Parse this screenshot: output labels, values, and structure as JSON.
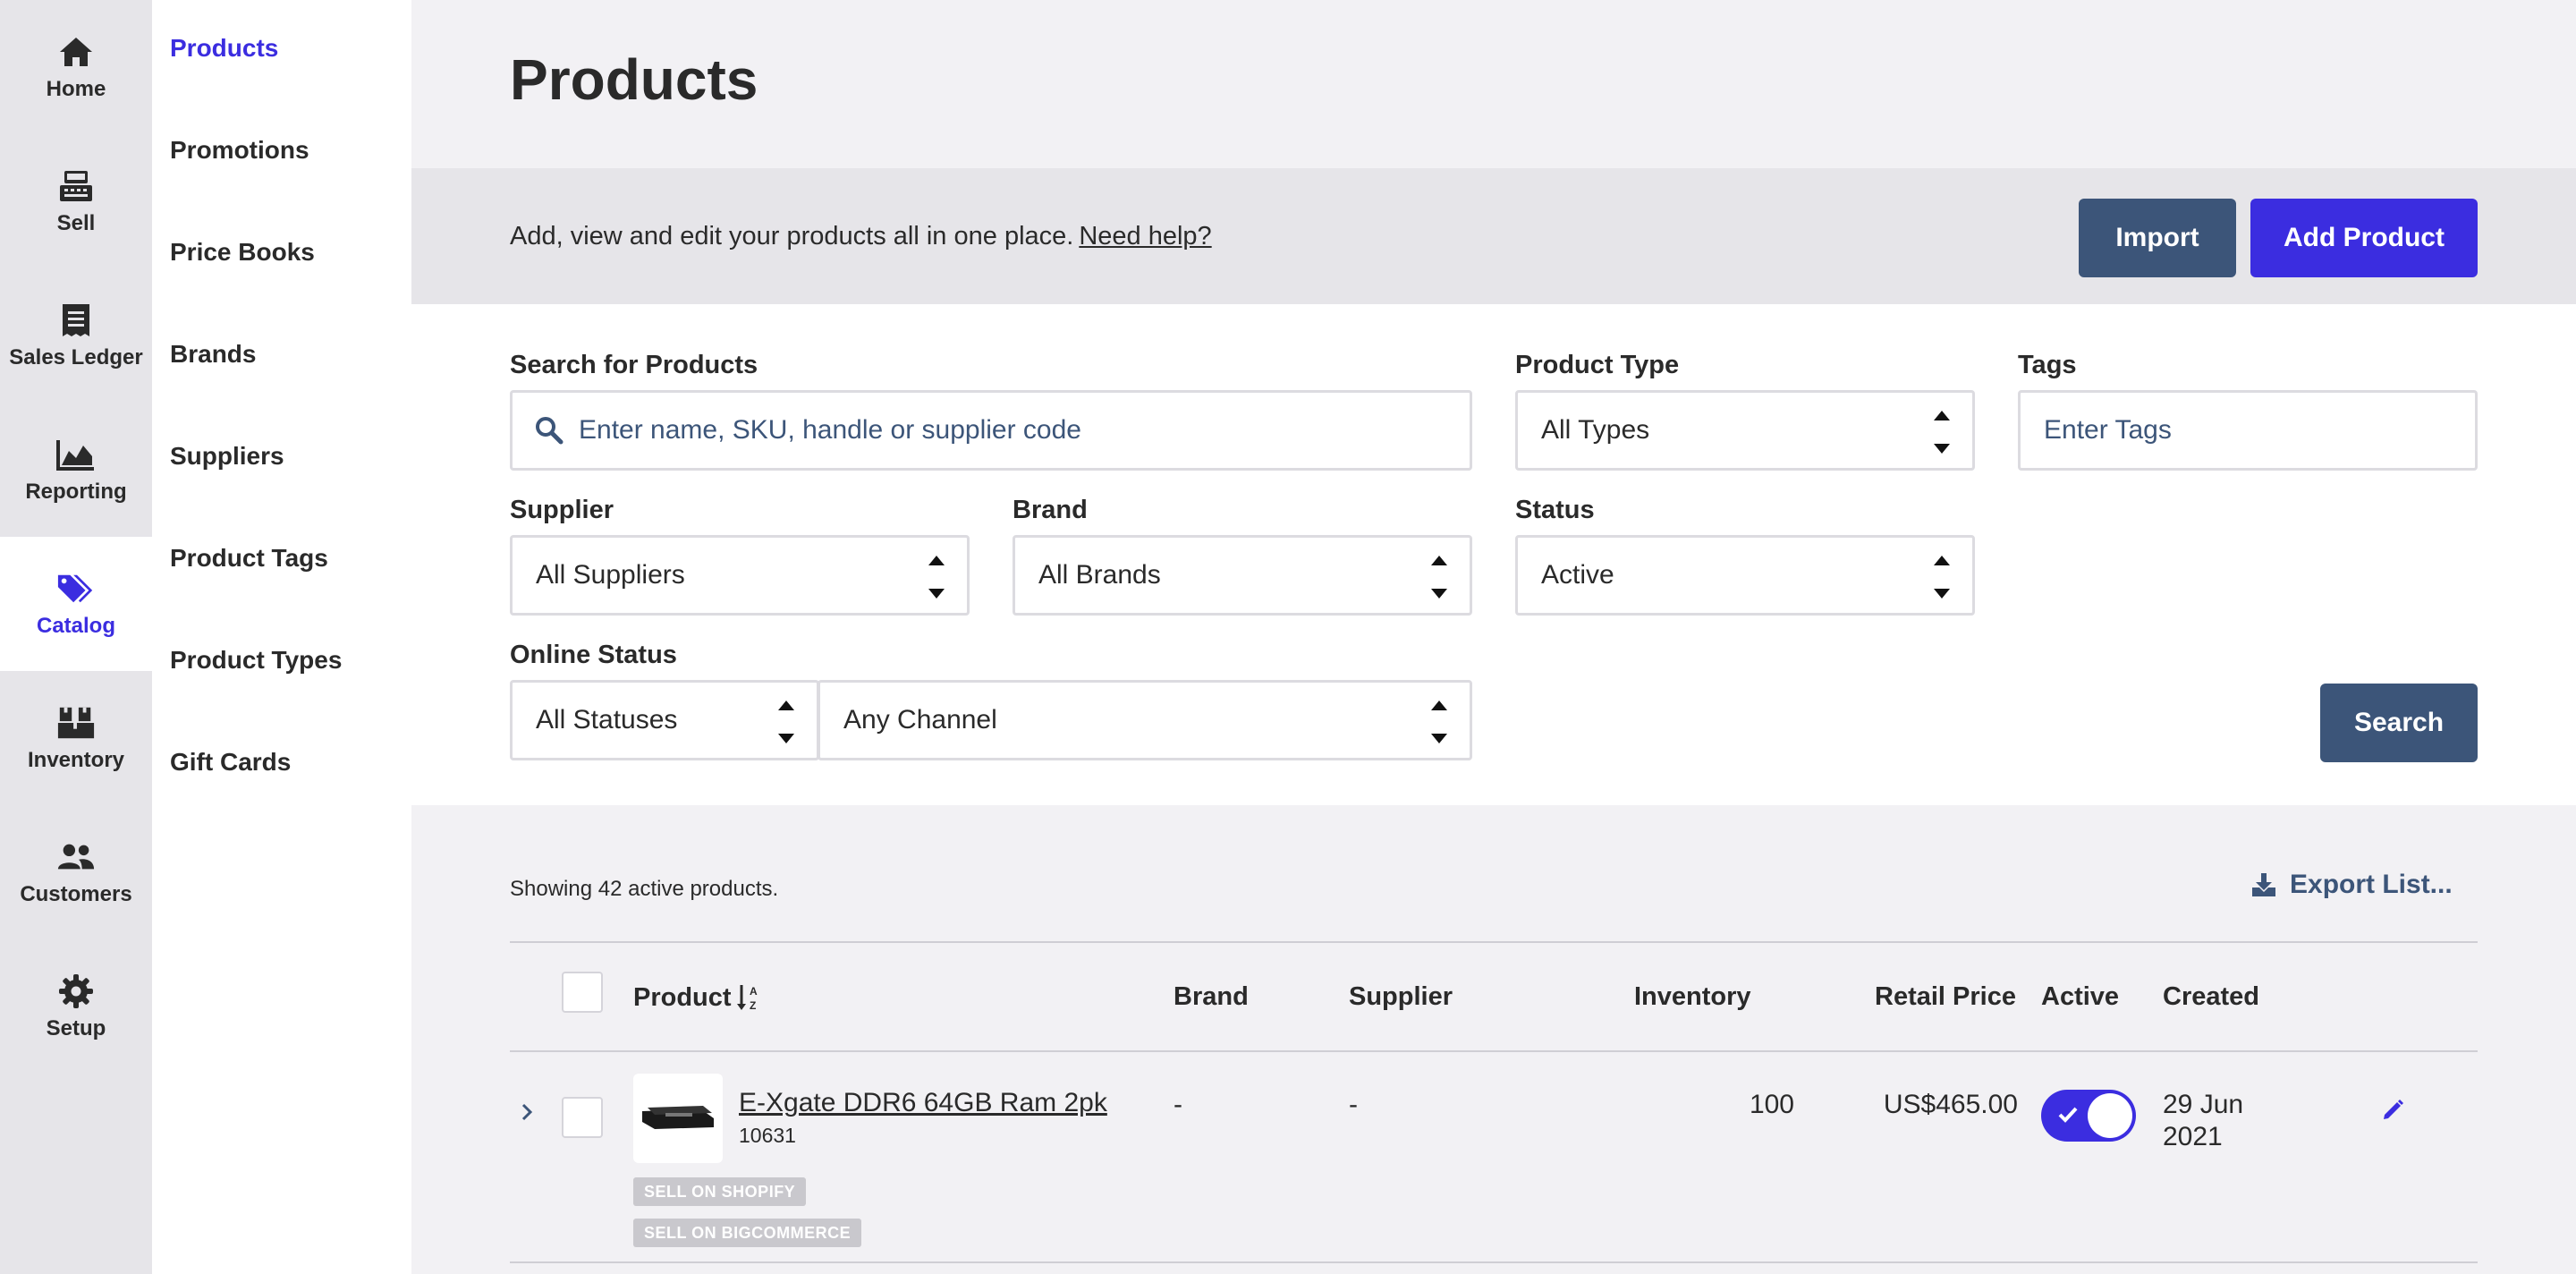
{
  "rail": {
    "items": [
      {
        "label": "Home",
        "icon": "home-icon"
      },
      {
        "label": "Sell",
        "icon": "register-icon"
      },
      {
        "label": "Sales Ledger",
        "icon": "receipt-icon"
      },
      {
        "label": "Reporting",
        "icon": "chart-icon"
      },
      {
        "label": "Catalog",
        "icon": "tags-icon",
        "active": true
      },
      {
        "label": "Inventory",
        "icon": "boxes-icon"
      },
      {
        "label": "Customers",
        "icon": "users-icon"
      },
      {
        "label": "Setup",
        "icon": "gear-icon"
      }
    ]
  },
  "subnav": {
    "items": [
      {
        "label": "Products",
        "active": true
      },
      {
        "label": "Promotions"
      },
      {
        "label": "Price Books"
      },
      {
        "label": "Brands"
      },
      {
        "label": "Suppliers"
      },
      {
        "label": "Product Tags"
      },
      {
        "label": "Product Types"
      },
      {
        "label": "Gift Cards"
      }
    ]
  },
  "page": {
    "title": "Products"
  },
  "banner": {
    "text": "Add, view and edit your products all in one place.",
    "help_link": "Need help?",
    "import_label": "Import",
    "add_label": "Add Product"
  },
  "filters": {
    "search_label": "Search for Products",
    "search_placeholder": "Enter name, SKU, handle or supplier code",
    "type_label": "Product Type",
    "type_value": "All Types",
    "tags_label": "Tags",
    "tags_placeholder": "Enter Tags",
    "supplier_label": "Supplier",
    "supplier_value": "All Suppliers",
    "brand_label": "Brand",
    "brand_value": "All Brands",
    "status_label": "Status",
    "status_value": "Active",
    "online_label": "Online Status",
    "online_value": "All Statuses",
    "channel_value": "Any Channel",
    "search_button": "Search"
  },
  "list": {
    "showing": "Showing 42 active products.",
    "export_label": "Export List...",
    "columns": {
      "product": "Product",
      "brand": "Brand",
      "supplier": "Supplier",
      "inventory": "Inventory",
      "retail_price": "Retail Price",
      "active": "Active",
      "created": "Created"
    },
    "rows": [
      {
        "name": "E-Xgate DDR6 64GB Ram 2pk",
        "sku": "10631",
        "brand": "-",
        "supplier": "-",
        "inventory": "100",
        "retail_price": "US$465.00",
        "active": true,
        "created_line1": "29 Jun",
        "created_line2": "2021",
        "badges": [
          "SELL ON SHOPIFY",
          "SELL ON BIGCOMMERCE"
        ]
      }
    ]
  },
  "colors": {
    "accent": "#3b2de0",
    "slate": "#3c5579",
    "rail_bg": "#e6e5e9"
  }
}
